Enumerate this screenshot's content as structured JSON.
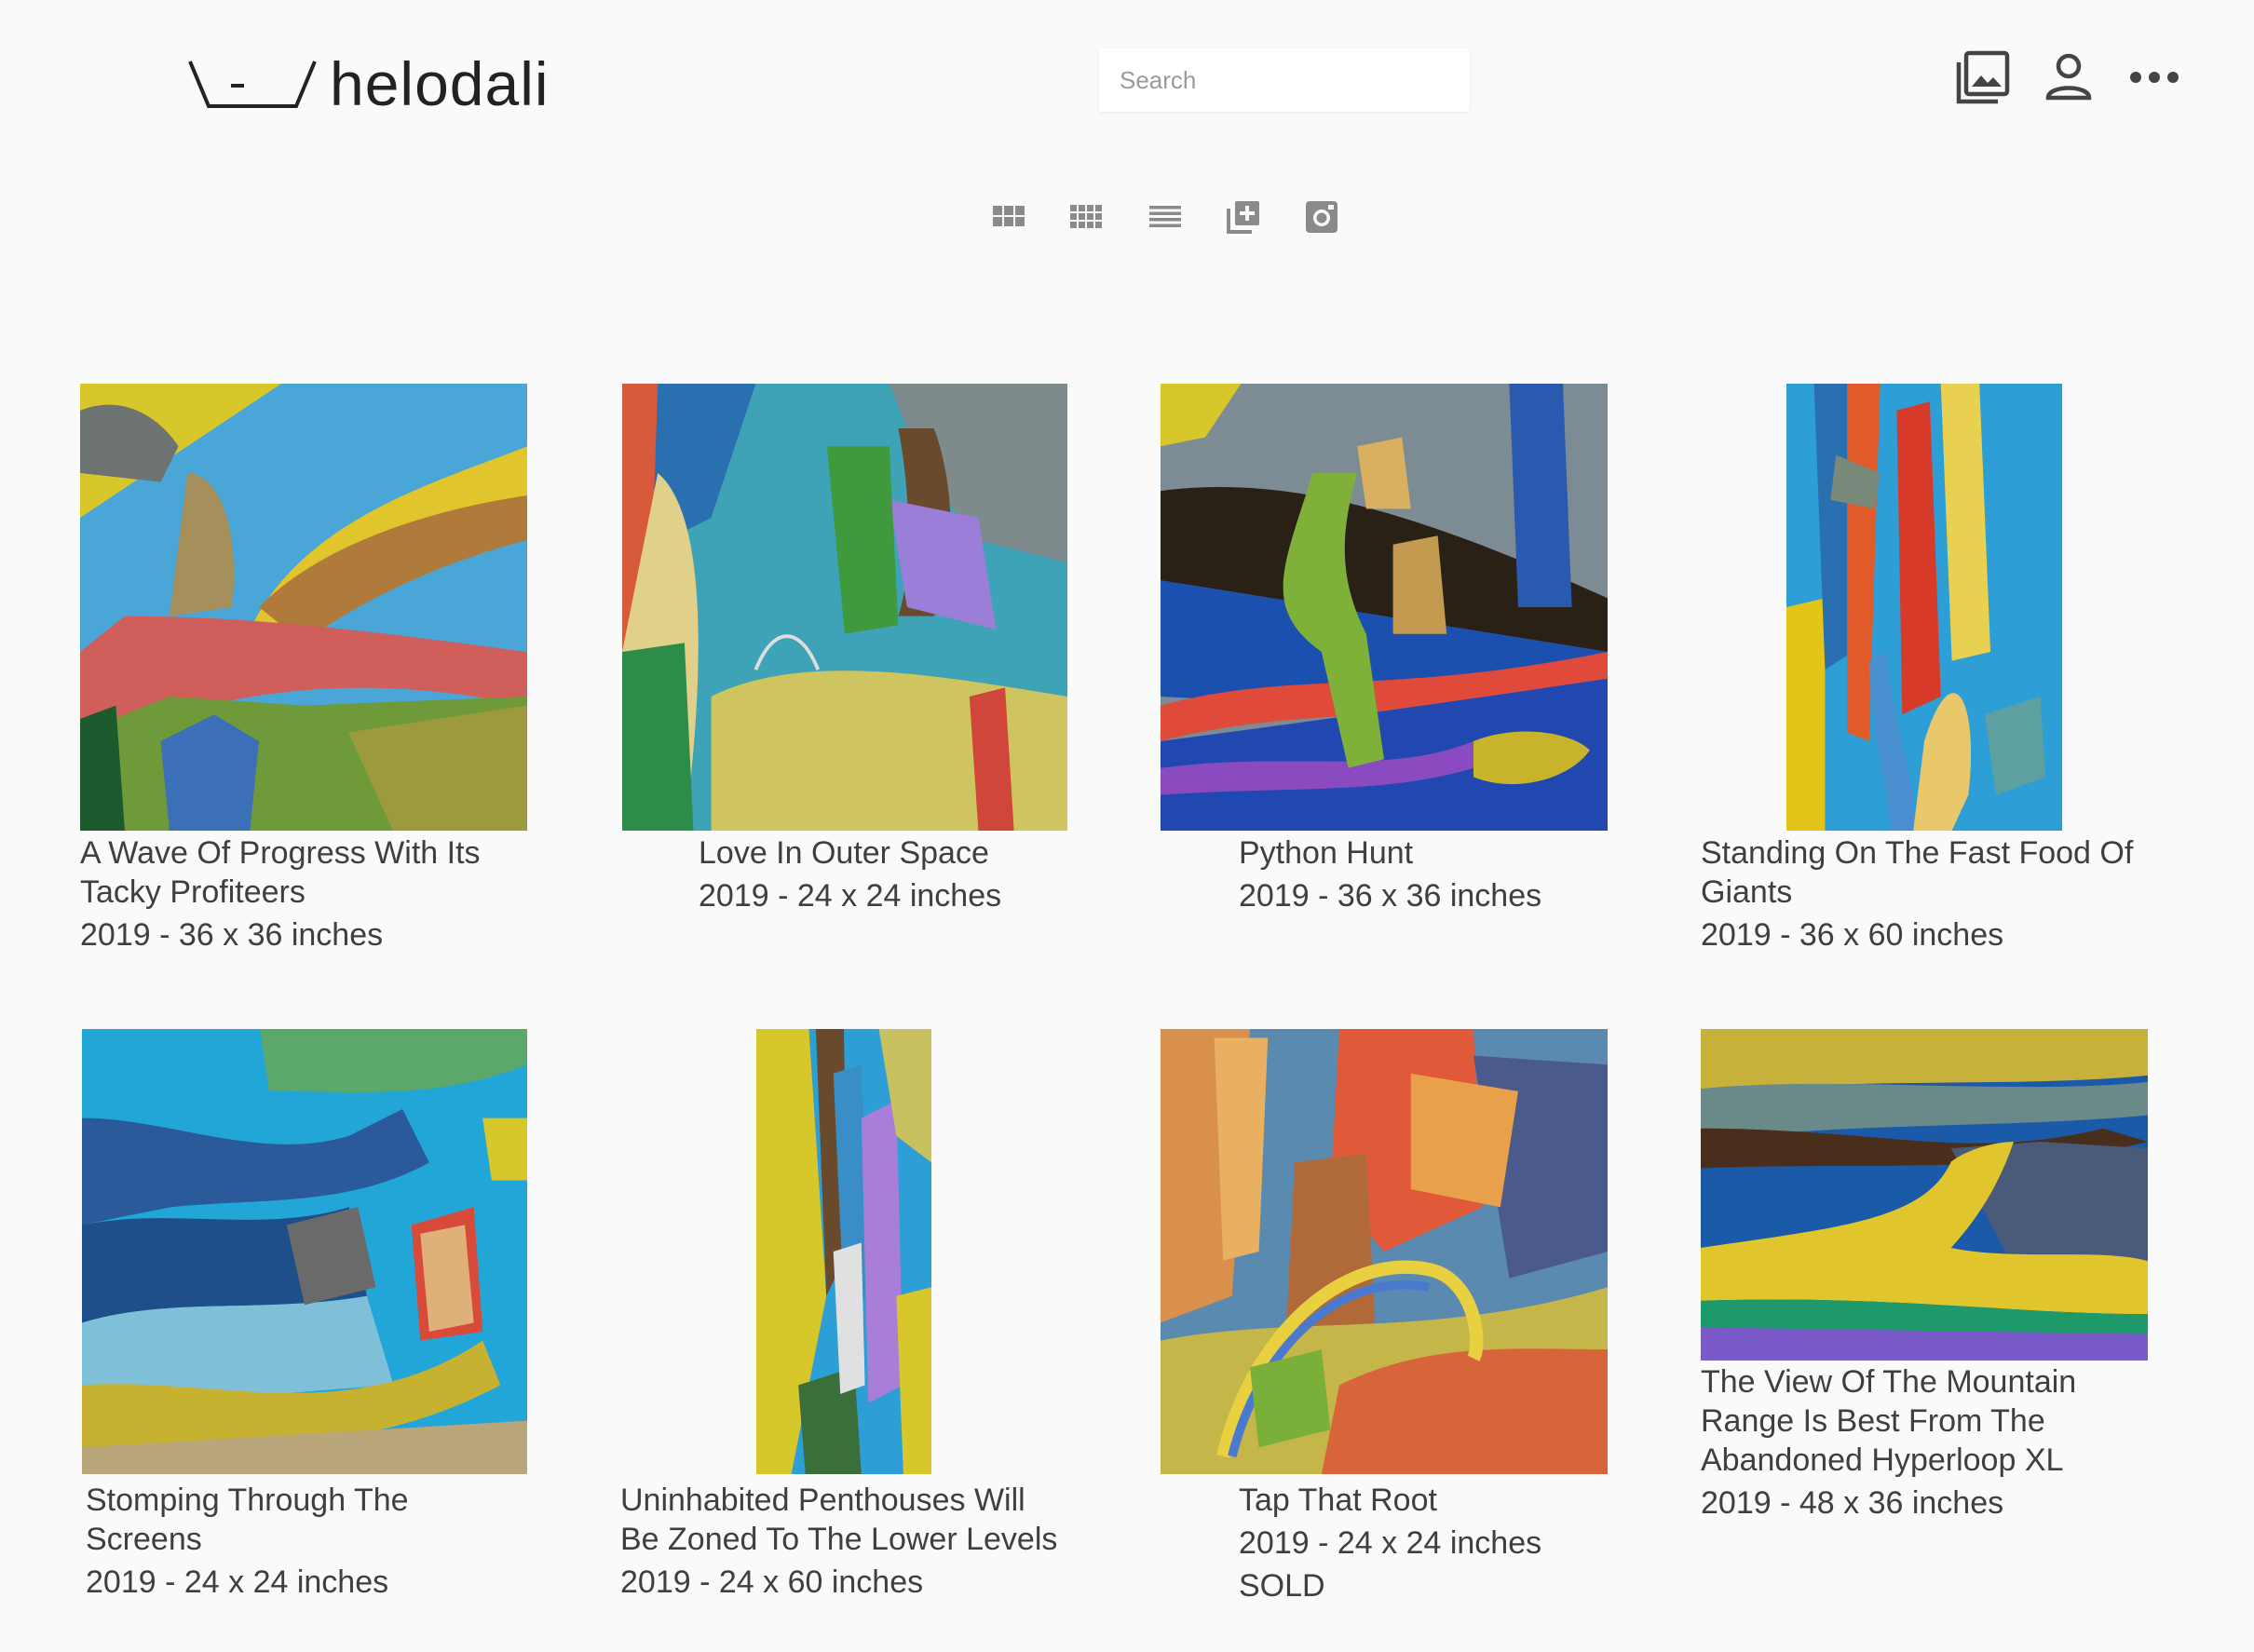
{
  "header": {
    "logo_text": "helodali",
    "search_placeholder": "Search",
    "icons": [
      "gallery-icon",
      "account-icon",
      "more-icon"
    ]
  },
  "view_switcher": {
    "icons": [
      "grid-large-icon",
      "grid-small-icon",
      "list-icon",
      "add-artwork-icon",
      "instagram-icon"
    ]
  },
  "artworks": [
    {
      "title": "A Wave Of Progress With Its Tacky Profiteers",
      "meta": "2019 - 36 x 36 inches",
      "status": ""
    },
    {
      "title": "Love In Outer Space",
      "meta": "2019 - 24 x 24 inches",
      "status": ""
    },
    {
      "title": "Python Hunt",
      "meta": "2019 - 36 x 36 inches",
      "status": ""
    },
    {
      "title": "Standing On The Fast Food Of Giants",
      "meta": "2019 - 36 x 60 inches",
      "status": ""
    },
    {
      "title": "Stomping Through The Screens",
      "meta": "2019 - 24 x 24 inches",
      "status": ""
    },
    {
      "title": "Uninhabited Penthouses Will Be Zoned To The Lower Levels",
      "meta": "2019 - 24 x 60 inches",
      "status": ""
    },
    {
      "title": "Tap That Root",
      "meta": "2019 - 24 x 24 inches",
      "status": "SOLD"
    },
    {
      "title": "The View Of The Mountain Range Is Best From The Abandoned Hyperloop XL",
      "meta": "2019 - 48 x 36 inches",
      "status": ""
    }
  ]
}
